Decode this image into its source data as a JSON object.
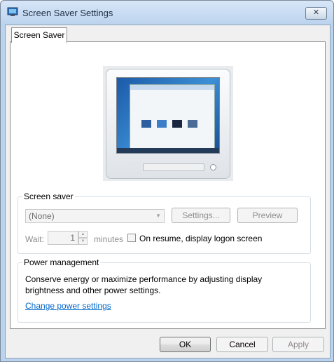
{
  "window": {
    "title": "Screen Saver Settings",
    "close_label": "✕",
    "icons": [
      "app-icon",
      "close-icon"
    ]
  },
  "tab": {
    "label": "Screen Saver"
  },
  "screen_saver": {
    "group_label": "Screen saver",
    "selected": "(None)",
    "settings_label": "Settings...",
    "preview_label": "Preview",
    "wait_label": "Wait:",
    "wait_value": "1",
    "minutes_label": "minutes",
    "on_resume_label": "On resume, display logon screen",
    "on_resume_checked": false
  },
  "power": {
    "group_label": "Power management",
    "description": "Conserve energy or maximize performance by adjusting display brightness and other power settings.",
    "link_label": "Change power settings"
  },
  "buttons": {
    "ok": "OK",
    "cancel": "Cancel",
    "apply": "Apply"
  },
  "colors": {
    "title_bar": "#bcd3ee",
    "link": "#0066cc",
    "disabled_text": "#8d8d8d"
  }
}
